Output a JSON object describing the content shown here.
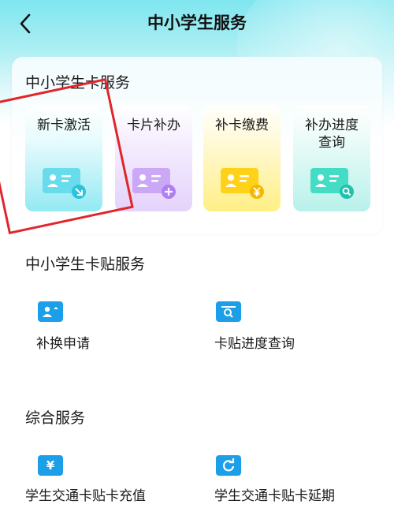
{
  "header": {
    "title": "中小学生服务"
  },
  "student_card": {
    "title": "中小学生卡服务",
    "tiles": [
      {
        "label_line1": "新卡激活",
        "label_line2": "",
        "icon": "card-arrow-icon",
        "color": "#4fd3e6"
      },
      {
        "label_line1": "卡片补办",
        "label_line2": "",
        "icon": "card-plus-icon",
        "color": "#c79bf5"
      },
      {
        "label_line1": "补卡缴费",
        "label_line2": "",
        "icon": "card-yen-icon",
        "color": "#ffd21a"
      },
      {
        "label_line1": "补办进度",
        "label_line2": "查询",
        "icon": "card-search-icon",
        "color": "#45dcc5"
      }
    ]
  },
  "subsidy": {
    "title": "中小学生卡贴服务",
    "items": [
      {
        "label": "补换申请",
        "icon": "person-card-icon"
      },
      {
        "label": "卡贴进度查询",
        "icon": "search-card-icon"
      }
    ]
  },
  "general": {
    "title": "综合服务",
    "items": [
      {
        "label": "学生交通卡贴卡充值",
        "icon": "yen-icon"
      },
      {
        "label": "学生交通卡贴卡延期",
        "icon": "refresh-icon"
      }
    ]
  },
  "colors": {
    "accent": "#1a9fe8",
    "highlight": "#e0262a"
  }
}
